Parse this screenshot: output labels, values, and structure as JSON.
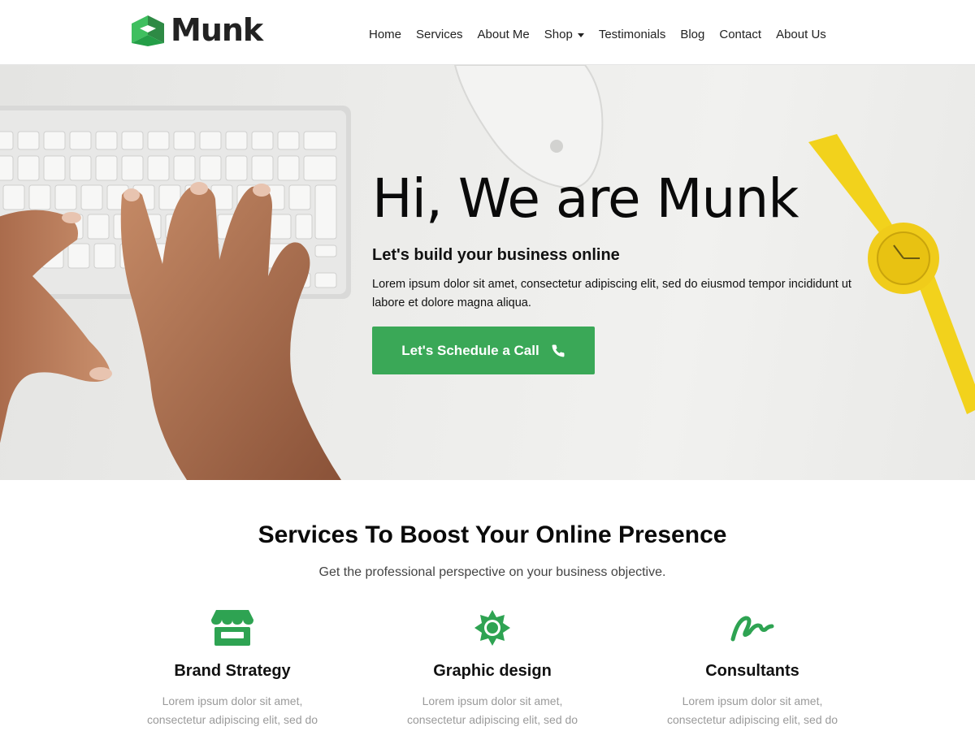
{
  "brand": {
    "name": "Munk",
    "accent": "#3aa857"
  },
  "nav": {
    "items": [
      {
        "label": "Home"
      },
      {
        "label": "Services"
      },
      {
        "label": "About Me"
      },
      {
        "label": "Shop",
        "has_dropdown": true
      },
      {
        "label": "Testimonials"
      },
      {
        "label": "Blog"
      },
      {
        "label": "Contact"
      },
      {
        "label": "About Us"
      }
    ]
  },
  "hero": {
    "title": "Hi, We are Munk",
    "subtitle": "Let's build your business online",
    "text": "Lorem ipsum dolor sit amet, consectetur adipiscing elit, sed do eiusmod tempor incididunt ut labore et dolore magna aliqua.",
    "cta_label": "Let's Schedule a Call",
    "cta_icon": "phone-icon",
    "background_image": "hands-typing-on-keyboard-with-mouse-and-yellow-watch"
  },
  "services": {
    "title": "Services To Boost Your Online Presence",
    "subtitle": "Get the professional perspective on your business objective.",
    "cards": [
      {
        "icon": "store-icon",
        "title": "Brand Strategy",
        "text": "Lorem ipsum dolor sit amet, consectetur adipiscing elit, sed do"
      },
      {
        "icon": "sun-gear-icon",
        "title": "Graphic design",
        "text": "Lorem ipsum dolor sit amet, consectetur adipiscing elit, sed do"
      },
      {
        "icon": "signature-icon",
        "title": "Consultants",
        "text": "Lorem ipsum dolor sit amet, consectetur adipiscing elit, sed do"
      }
    ]
  }
}
